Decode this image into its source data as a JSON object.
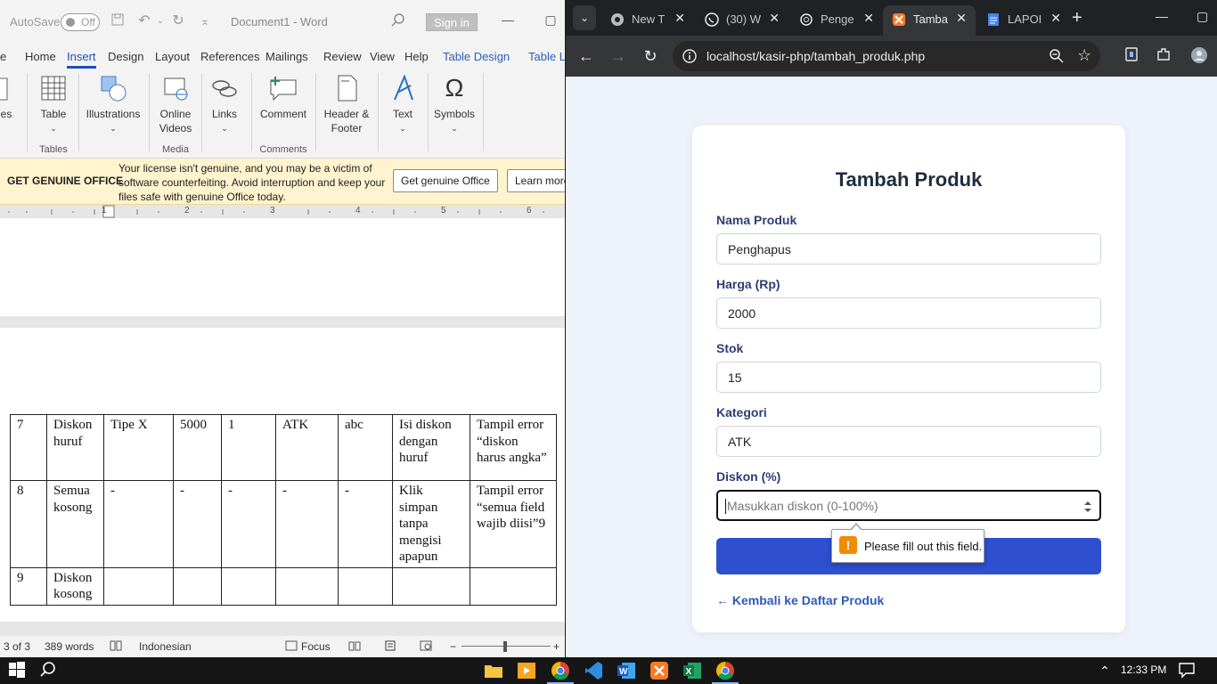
{
  "word": {
    "autosave_label": "AutoSave",
    "autosave_state": "Off",
    "doc_title": "Document1  -  Word",
    "signin_label": "Sign in",
    "tabs": [
      "e",
      "Home",
      "Insert",
      "Design",
      "Layout",
      "References",
      "Mailings",
      "Review",
      "View",
      "Help",
      "Table Design",
      "Table L"
    ],
    "active_tab": "Insert",
    "ribbon": {
      "pages_label": "ges",
      "table_label": "Table",
      "illustrations_label": "Illustrations",
      "online_videos_label": "Online Videos",
      "online_videos_l1": "Online",
      "online_videos_l2": "Videos",
      "links_label": "Links",
      "comment_label": "Comment",
      "header_footer_l1": "Header &",
      "header_footer_l2": "Footer",
      "text_label": "Text",
      "symbols_label": "Symbols",
      "groups": {
        "tables": "Tables",
        "media": "Media",
        "comments": "Comments"
      }
    },
    "infobar": {
      "title": "GET GENUINE OFFICE",
      "message": "Your license isn't genuine, and you may be a victim of software counterfeiting. Avoid interruption and keep your files safe with genuine Office today.",
      "button_genuine": "Get genuine Office",
      "button_learn": "Learn more"
    },
    "ruler_numbers": [
      "1",
      "2",
      "3",
      "4",
      "5",
      "6"
    ],
    "table_rows": [
      [
        "7",
        "Diskon huruf",
        "Tipe X",
        "5000",
        "1",
        "ATK",
        "abc",
        "Isi diskon dengan huruf",
        "Tampil error “diskon harus angka”"
      ],
      [
        "8",
        "Semua kosong",
        "-",
        "-",
        "-",
        "-",
        "-",
        "Klik simpan tanpa mengisi apapun",
        "Tampil error “semua field wajib diisi”9"
      ],
      [
        "9",
        "Diskon kosong",
        "",
        "",
        "",
        "",
        "",
        "",
        ""
      ]
    ],
    "status": {
      "page": "3 of 3",
      "words": "389 words",
      "language": "Indonesian",
      "focus": "Focus"
    }
  },
  "browser": {
    "tabs": [
      {
        "title": "New T",
        "icon": "chrome-icon"
      },
      {
        "title": "(30) W",
        "icon": "whatsapp-icon"
      },
      {
        "title": "Penge",
        "icon": "openai-icon"
      },
      {
        "title": "Tamba",
        "icon": "xampp-icon",
        "active": true
      },
      {
        "title": "LAPOI",
        "icon": "docs-icon"
      }
    ],
    "url": "localhost/kasir-php/tambah_produk.php"
  },
  "form": {
    "title": "Tambah Produk",
    "fields": [
      {
        "label": "Nama Produk",
        "value": "Penghapus"
      },
      {
        "label": "Harga (Rp)",
        "value": "2000"
      },
      {
        "label": "Stok",
        "value": "15"
      },
      {
        "label": "Kategori",
        "value": "ATK"
      },
      {
        "label": "Diskon (%)",
        "value": "",
        "placeholder": "Masukkan diskon (0-100%)"
      }
    ],
    "validation_message": "Please fill out this field.",
    "back_link": "← Kembali ke Daftar Produk"
  },
  "taskbar": {
    "time": "12:33 PM"
  },
  "colors": {
    "word_accent": "#1e4fb4",
    "infobar_bg": "#fff4ce",
    "form_button": "#2e4fd0",
    "form_label": "#2c3e75",
    "page_bg": "#eef2fb"
  }
}
